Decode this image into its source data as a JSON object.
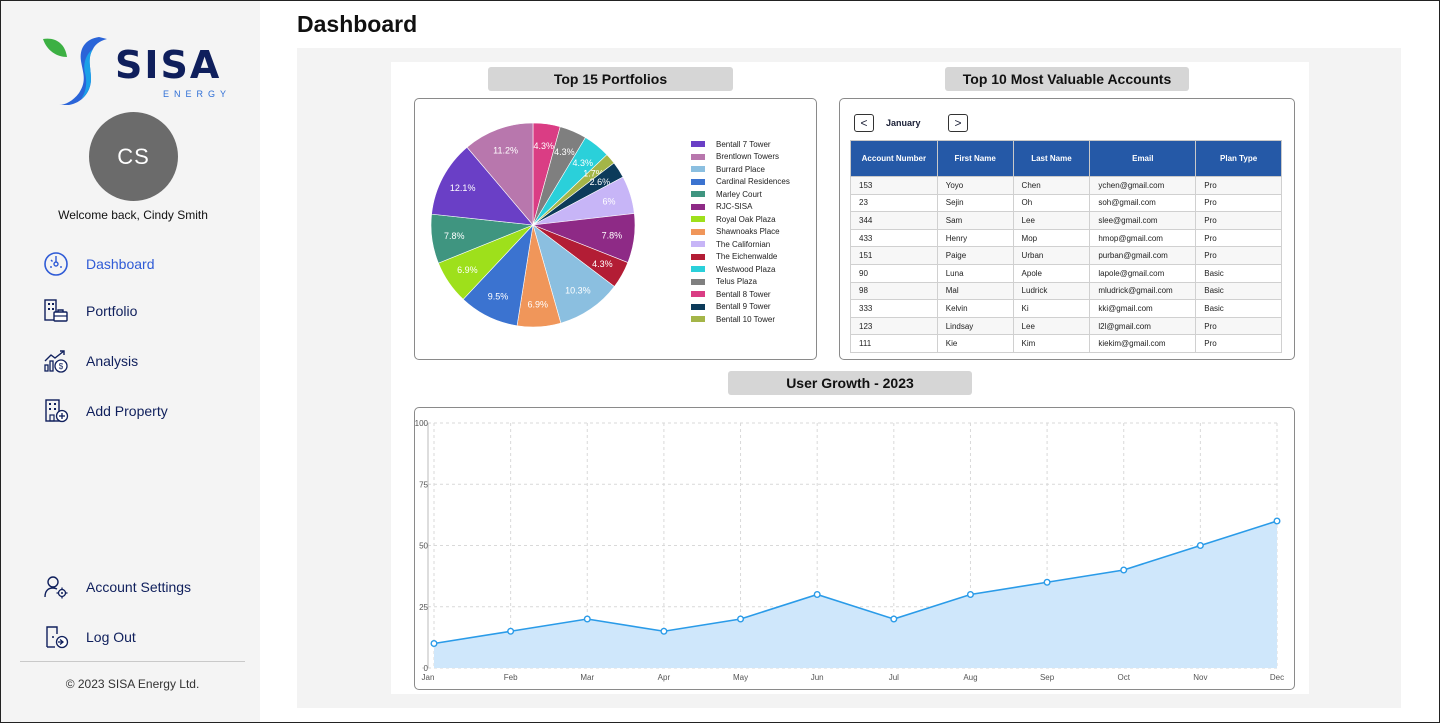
{
  "app": {
    "logo_text": "SISA",
    "logo_sub": "ENERGY",
    "avatar_initials": "CS",
    "welcome": "Welcome back, Cindy Smith",
    "copyright": "© 2023 SISA Energy Ltd."
  },
  "nav": {
    "dashboard": "Dashboard",
    "portfolio": "Portfolio",
    "analysis": "Analysis",
    "add_property": "Add Property",
    "account_settings": "Account Settings",
    "log_out": "Log Out"
  },
  "page": {
    "title": "Dashboard"
  },
  "colors": {
    "accent": "#2f5bd6",
    "brand_navy": "#0f1f5c",
    "table_header": "#2559a7",
    "line": "#2a9be8",
    "area": "#cfe7fb"
  },
  "portfolios": {
    "title": "Top 15 Portfolios"
  },
  "accounts": {
    "title": "Top 10 Most Valuable Accounts",
    "month": "January",
    "prev": "<",
    "next": ">",
    "columns": [
      "Account Number",
      "First Name",
      "Last Name",
      "Email",
      "Plan Type"
    ],
    "rows": [
      [
        "153",
        "Yoyo",
        "Chen",
        "ychen@gmail.com",
        "Pro"
      ],
      [
        "23",
        "Sejin",
        "Oh",
        "soh@gmail.com",
        "Pro"
      ],
      [
        "344",
        "Sam",
        "Lee",
        "slee@gmail.com",
        "Pro"
      ],
      [
        "433",
        "Henry",
        "Mop",
        "hmop@gmail.com",
        "Pro"
      ],
      [
        "151",
        "Paige",
        "Urban",
        "purban@gmail.com",
        "Pro"
      ],
      [
        "90",
        "Luna",
        "Apole",
        "lapole@gmail.com",
        "Basic"
      ],
      [
        "98",
        "Mal",
        "Ludrick",
        "mludrick@gmail.com",
        "Basic"
      ],
      [
        "333",
        "Kelvin",
        "Ki",
        "kki@gmail.com",
        "Basic"
      ],
      [
        "123",
        "Lindsay",
        "Lee",
        "l2l@gmail.com",
        "Pro"
      ],
      [
        "111",
        "Kie",
        "Kim",
        "kiekim@gmail.com",
        "Pro"
      ]
    ]
  },
  "growth": {
    "title": "User Growth - 2023"
  },
  "chart_data": [
    {
      "type": "pie",
      "title": "Top 15 Portfolios",
      "slices": [
        {
          "name": "Bentall 7 Tower",
          "value": 12.1,
          "label": "12.1%",
          "color": "#6a3fc6"
        },
        {
          "name": "Brentlown Towers",
          "value": 11.2,
          "label": "11.2%",
          "color": "#b877ad"
        },
        {
          "name": "Burrard Place",
          "value": 10.3,
          "label": "10.3%",
          "color": "#8bbfe0"
        },
        {
          "name": "Cardinal Residences",
          "value": 9.5,
          "label": "9.5%",
          "color": "#3b73d0"
        },
        {
          "name": "Marley Court",
          "value": 7.8,
          "label": "7.8%",
          "color": "#3f9580"
        },
        {
          "name": "RJC-SISA",
          "value": 7.8,
          "label": "7.8%",
          "color": "#8e2a86"
        },
        {
          "name": "Royal Oak Plaza",
          "value": 6.9,
          "label": "6.9%",
          "color": "#9ee01b"
        },
        {
          "name": "Shawnoaks Place",
          "value": 6.9,
          "label": "6.9%",
          "color": "#f0965a"
        },
        {
          "name": "The Californian",
          "value": 6,
          "label": "6%",
          "color": "#c7b5f7"
        },
        {
          "name": "The Eichenwalde",
          "value": 4.3,
          "label": "4.3%",
          "color": "#b31d35"
        },
        {
          "name": "Westwood Plaza",
          "value": 4.3,
          "label": "4.3%",
          "color": "#2ad0da"
        },
        {
          "name": "Telus Plaza",
          "value": 4.3,
          "label": "4.3%",
          "color": "#7f7f7f"
        },
        {
          "name": "Bentall 8 Tower",
          "value": 4.3,
          "label": "4.3%",
          "color": "#da3d84"
        },
        {
          "name": "Bentall 9 Tower",
          "value": 2.6,
          "label": "2.6%",
          "color": "#0c3b5a"
        },
        {
          "name": "Bentall 10 Tower",
          "value": 1.7,
          "label": "1.7%",
          "color": "#a4b548"
        }
      ]
    },
    {
      "type": "area",
      "title": "User Growth - 2023",
      "x": [
        "Jan",
        "Feb",
        "Mar",
        "Apr",
        "May",
        "Jun",
        "Jul",
        "Aug",
        "Sep",
        "Oct",
        "Nov",
        "Dec"
      ],
      "values": [
        10,
        15,
        20,
        15,
        20,
        30,
        20,
        30,
        35,
        40,
        50,
        60
      ],
      "ylim": [
        0,
        100
      ],
      "yticks": [
        0,
        25,
        50,
        75,
        100
      ],
      "grid": true
    }
  ]
}
